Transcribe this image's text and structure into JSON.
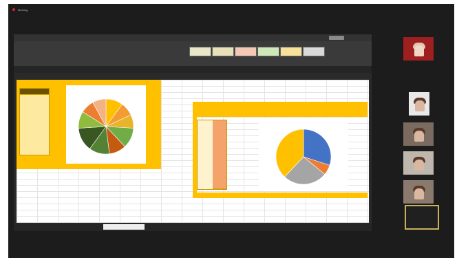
{
  "meeting": {
    "title": "Meeting"
  },
  "excel": {
    "workbook_title": "",
    "share_label": "",
    "sheet_tab": "",
    "style_colors": [
      "#e9e5c7",
      "#e7e1b8",
      "#f3c9b6",
      "#cfe6b8",
      "#f7e09a",
      "#d9d9d9"
    ]
  },
  "left_panel": {
    "chart": {
      "title": "",
      "type": "pie",
      "slices": [
        {
          "color": "#ffc000",
          "value": 10
        },
        {
          "color": "#f39c33",
          "value": 8
        },
        {
          "color": "#e8b52a",
          "value": 8
        },
        {
          "color": "#70ad47",
          "value": 12
        },
        {
          "color": "#c55a11",
          "value": 10
        },
        {
          "color": "#548235",
          "value": 12
        },
        {
          "color": "#385723",
          "value": 14
        },
        {
          "color": "#8fbc3f",
          "value": 10
        },
        {
          "color": "#ed7d31",
          "value": 8
        },
        {
          "color": "#f4b183",
          "value": 8
        }
      ]
    }
  },
  "right_panel": {
    "chart": {
      "title": "",
      "type": "pie",
      "slices": [
        {
          "color": "#4472c4",
          "value": 30
        },
        {
          "color": "#ed7d31",
          "value": 6
        },
        {
          "color": "#a5a5a5",
          "value": 26
        },
        {
          "color": "#ffc000",
          "value": 38
        }
      ]
    }
  },
  "participants": [
    {
      "name": ""
    },
    {
      "name": ""
    },
    {
      "name": ""
    },
    {
      "name": ""
    },
    {
      "name": ""
    }
  ],
  "active_speaker": {
    "name": ""
  }
}
